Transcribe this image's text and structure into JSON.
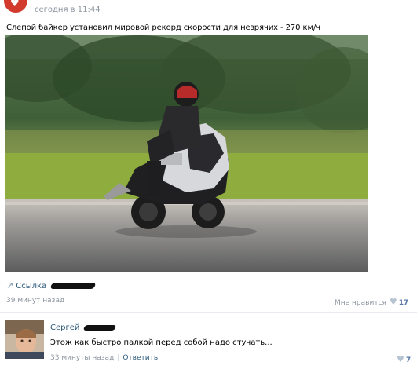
{
  "post": {
    "time": "сегодня в 11:44",
    "text": "Слепой байкер установил мировой рекорд скорости для незрячих - 270 км/ч",
    "photo_icon": "motorcycle-photo",
    "link_label": "Ссылка",
    "ago": "39 минут назад",
    "like_label": "Мне нравится",
    "like_count": "17",
    "brand_color": "#d23a2e"
  },
  "comment": {
    "author": "Сергей",
    "text": "Этож как быстро палкой перед собой надо стучать...",
    "ago": "33 минуты назад",
    "reply_label": "Ответить",
    "separator": "|",
    "like_count": "7"
  },
  "icons": {
    "link": "↗",
    "heart": "♥"
  }
}
